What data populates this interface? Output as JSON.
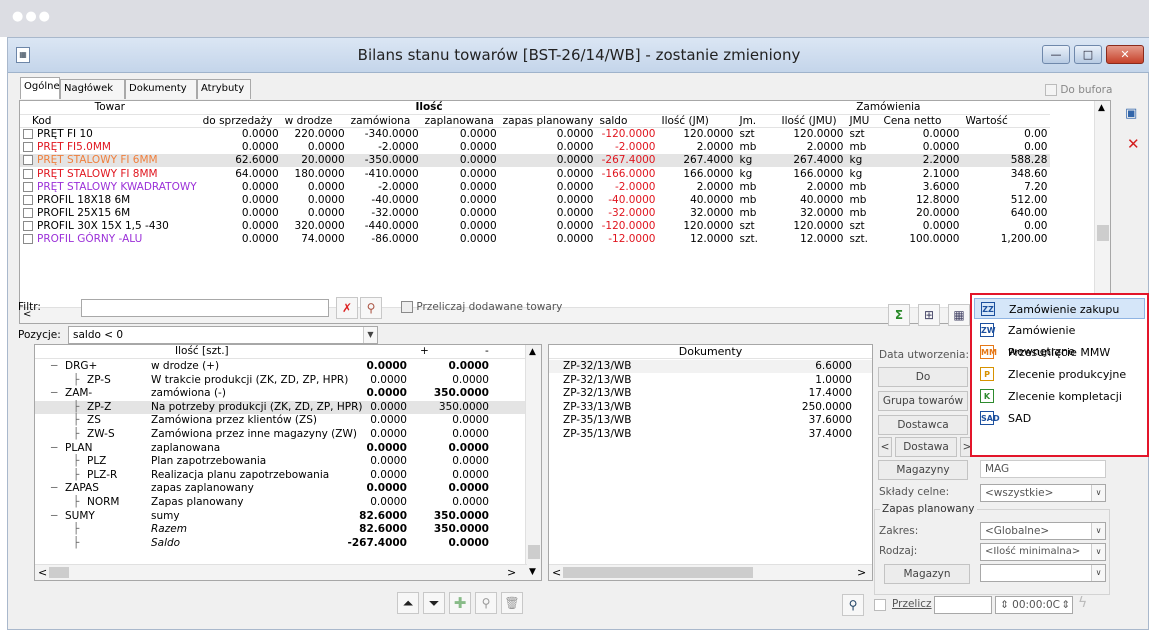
{
  "window": {
    "title": "Bilans stanu towarów [BST-26/14/WB] - zostanie zmieniony"
  },
  "tabs": [
    "Ogólne",
    "Nagłówek",
    "Dokumenty",
    "Atrybuty"
  ],
  "do_bufora": "Do bufora",
  "grid": {
    "group_headers": {
      "towar": "Towar",
      "ilosc": "Ilość",
      "zamowienia": "Zamówienia"
    },
    "columns": [
      "Kod",
      "do sprzedaży",
      "w drodze",
      "zamówiona",
      "zaplanowana",
      "zapas planowany",
      "saldo",
      "Ilość (JM)",
      "Jm.",
      "Ilość (JMU)",
      "JMU",
      "Cena netto",
      "Wartość"
    ],
    "rows": [
      {
        "kod": "PRĘT FI 10",
        "color": "#000000",
        "vals": [
          "0.0000",
          "220.0000",
          "-340.0000",
          "0.0000",
          "0.0000",
          "-120.0000",
          "120.0000",
          "szt",
          "120.0000",
          "szt",
          "0.0000",
          "0.00"
        ]
      },
      {
        "kod": "PRĘT FI5.0MM",
        "color": "#e0161f",
        "vals": [
          "0.0000",
          "0.0000",
          "-2.0000",
          "0.0000",
          "0.0000",
          "-2.0000",
          "2.0000",
          "mb",
          "2.0000",
          "mb",
          "0.0000",
          "0.00"
        ]
      },
      {
        "kod": "PRĘT STALOWY FI 6MM",
        "color": "#f07f3c",
        "vals": [
          "62.6000",
          "20.0000",
          "-350.0000",
          "0.0000",
          "0.0000",
          "-267.4000",
          "267.4000",
          "kg",
          "267.4000",
          "kg",
          "2.2000",
          "588.28"
        ]
      },
      {
        "kod": "PRĘT STALOWY FI 8MM",
        "color": "#e0161f",
        "vals": [
          "64.0000",
          "180.0000",
          "-410.0000",
          "0.0000",
          "0.0000",
          "-166.0000",
          "166.0000",
          "kg",
          "166.0000",
          "kg",
          "2.1000",
          "348.60"
        ]
      },
      {
        "kod": "PRĘT STALOWY KWADRATOWY",
        "color": "#9b30d8",
        "vals": [
          "0.0000",
          "0.0000",
          "-2.0000",
          "0.0000",
          "0.0000",
          "-2.0000",
          "2.0000",
          "mb",
          "2.0000",
          "mb",
          "3.6000",
          "7.20"
        ]
      },
      {
        "kod": "PROFIL 18X18 6M",
        "color": "#000000",
        "vals": [
          "0.0000",
          "0.0000",
          "-40.0000",
          "0.0000",
          "0.0000",
          "-40.0000",
          "40.0000",
          "mb",
          "40.0000",
          "mb",
          "12.8000",
          "512.00"
        ]
      },
      {
        "kod": "PROFIL 25X15 6M",
        "color": "#000000",
        "vals": [
          "0.0000",
          "0.0000",
          "-32.0000",
          "0.0000",
          "0.0000",
          "-32.0000",
          "32.0000",
          "mb",
          "32.0000",
          "mb",
          "20.0000",
          "640.00"
        ]
      },
      {
        "kod": "PROFIL 30X 15X 1,5 -430",
        "color": "#000000",
        "vals": [
          "0.0000",
          "320.0000",
          "-440.0000",
          "0.0000",
          "0.0000",
          "-120.0000",
          "120.0000",
          "szt",
          "120.0000",
          "szt",
          "0.0000",
          "0.00"
        ]
      },
      {
        "kod": "PROFIL GÓRNY -ALU",
        "color": "#9b30d8",
        "vals": [
          "0.0000",
          "74.0000",
          "-86.0000",
          "0.0000",
          "0.0000",
          "-12.0000",
          "12.0000",
          "szt.",
          "12.0000",
          "szt.",
          "100.0000",
          "1,200.00"
        ]
      }
    ]
  },
  "filter": {
    "label": "Filtr:",
    "value": "",
    "przeliczaj": "Przeliczaj dodawane towary"
  },
  "pozycje": {
    "label": "Pozycje:",
    "value": "saldo < 0"
  },
  "tree": {
    "headers": [
      "Ilość [szt.]",
      "+",
      "-"
    ],
    "rows": [
      {
        "code": "DRG+",
        "indent": 0,
        "desc": "w drodze (+)",
        "plus": "0.0000",
        "minus": "0.0000",
        "bold": true,
        "italic": false
      },
      {
        "code": "ZP-S",
        "indent": 1,
        "desc": "W trakcie produkcji (ZK, ZD, ZP, HPR)",
        "plus": "0.0000",
        "minus": "0.0000",
        "bold": false,
        "italic": false
      },
      {
        "code": "ZAM-",
        "indent": 0,
        "desc": "zamówiona (-)",
        "plus": "0.0000",
        "minus": "350.0000",
        "bold": true,
        "italic": false
      },
      {
        "code": "ZP-Z",
        "indent": 1,
        "desc": "Na potrzeby produkcji (ZK, ZD, ZP, HPR)",
        "plus": "0.0000",
        "minus": "350.0000",
        "bold": false,
        "italic": false,
        "sel": true
      },
      {
        "code": "ZS",
        "indent": 1,
        "desc": "Zamówiona przez klientów (ZS)",
        "plus": "0.0000",
        "minus": "0.0000",
        "bold": false,
        "italic": false
      },
      {
        "code": "ZW-S",
        "indent": 1,
        "desc": "Zamówiona przez inne magazyny (ZW)",
        "plus": "0.0000",
        "minus": "0.0000",
        "bold": false,
        "italic": false
      },
      {
        "code": "PLAN",
        "indent": 0,
        "desc": "zaplanowana",
        "plus": "0.0000",
        "minus": "0.0000",
        "bold": true,
        "italic": false
      },
      {
        "code": "PLZ",
        "indent": 1,
        "desc": "Plan zapotrzebowania",
        "plus": "0.0000",
        "minus": "0.0000",
        "bold": false,
        "italic": false
      },
      {
        "code": "PLZ-R",
        "indent": 1,
        "desc": "Realizacja planu zapotrzebowania",
        "plus": "0.0000",
        "minus": "0.0000",
        "bold": false,
        "italic": false
      },
      {
        "code": "ZAPAS",
        "indent": 0,
        "desc": "zapas zaplanowany",
        "plus": "0.0000",
        "minus": "0.0000",
        "bold": true,
        "italic": false
      },
      {
        "code": "NORM",
        "indent": 1,
        "desc": "Zapas planowany",
        "plus": "0.0000",
        "minus": "0.0000",
        "bold": false,
        "italic": false
      },
      {
        "code": "SUMY",
        "indent": 0,
        "desc": "sumy",
        "plus": "82.6000",
        "minus": "350.0000",
        "bold": true,
        "italic": false
      },
      {
        "code": "",
        "indent": 1,
        "desc": "Razem",
        "plus": "82.6000",
        "minus": "350.0000",
        "bold": true,
        "italic": true
      },
      {
        "code": "",
        "indent": 1,
        "desc": "Saldo",
        "plus": "-267.4000",
        "minus": "0.0000",
        "bold": true,
        "italic": true
      }
    ]
  },
  "docs": {
    "header": "Dokumenty",
    "rows": [
      [
        "ZP-32/13/WB",
        "6.6000"
      ],
      [
        "ZP-32/13/WB",
        "1.0000"
      ],
      [
        "ZP-32/13/WB",
        "17.4000"
      ],
      [
        "ZP-33/13/WB",
        "250.0000"
      ],
      [
        "ZP-35/13/WB",
        "37.6000"
      ],
      [
        "ZP-35/13/WB",
        "37.4000"
      ]
    ]
  },
  "right": {
    "data_utworzenia": "Data utworzenia:",
    "do": "Do",
    "grupa": "Grupa towarów",
    "dostawca": "Dostawca",
    "dostawa": "Dostawa",
    "magazyny": "Magazyny",
    "mag": "MAG",
    "sklady_label": "Składy celne:",
    "sklady_value": "<wszystkie>",
    "zapas_group": "Zapas planowany",
    "zakres_label": "Zakres:",
    "zakres_value": "<Globalne>",
    "rodzaj_label": "Rodzaj:",
    "rodzaj_value": "<Ilość minimalna>",
    "magazyn": "Magazyn",
    "przelicz": "Przelicz",
    "time": "00:00:0C"
  },
  "menu": [
    {
      "icon": "ZZ",
      "label": "Zamówienie zakupu",
      "icon_color": "#1b4f9e"
    },
    {
      "icon": "ZW",
      "label": "Zamówienie wewnętrzne",
      "icon_color": "#1b4f9e"
    },
    {
      "icon": "MM",
      "label": "Przesunięcie MMW",
      "icon_color": "#e67817"
    },
    {
      "icon": "P",
      "label": "Zlecenie produkcyjne",
      "icon_color": "#d79200"
    },
    {
      "icon": "K",
      "label": "Zlecenie kompletacji",
      "icon_color": "#2e8b2e"
    },
    {
      "icon": "SAD",
      "label": "SAD",
      "icon_color": "#1b4f9e"
    }
  ]
}
